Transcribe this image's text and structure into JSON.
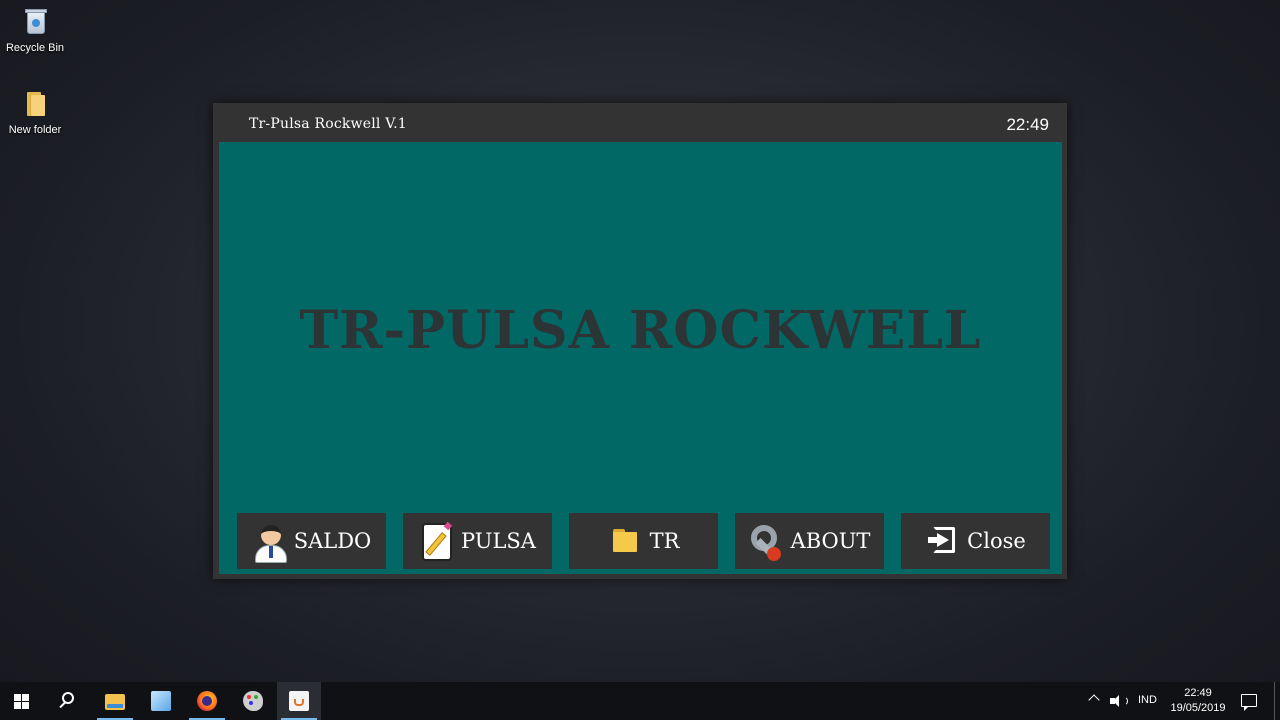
{
  "desktop": {
    "icons": [
      {
        "label": "Recycle Bin",
        "icon": "recycle-bin-icon"
      },
      {
        "label": "New folder",
        "icon": "folder-icon"
      }
    ]
  },
  "window": {
    "title": "Tr-Pulsa Rockwell V.1",
    "clock": "22:49",
    "banner": "TR-PULSA ROCKWELL",
    "colors": {
      "panel": "#016866",
      "chrome": "#333333",
      "banner_text": "#2c3436"
    },
    "buttons": [
      {
        "label": "SALDO",
        "icon": "user-icon"
      },
      {
        "label": "PULSA",
        "icon": "notepad-icon"
      },
      {
        "label": "TR",
        "icon": "folder-icon"
      },
      {
        "label": "ABOUT",
        "icon": "wrench-icon"
      },
      {
        "label": "Close",
        "icon": "exit-icon"
      }
    ]
  },
  "taskbar": {
    "apps": [
      "start-icon",
      "search-icon",
      "file-explorer-icon",
      "cube-app-icon",
      "firefox-icon",
      "paint-icon",
      "java-icon"
    ],
    "active_app": "java-icon",
    "tray": {
      "language": "IND",
      "time": "22:49",
      "date": "19/05/2019"
    }
  }
}
